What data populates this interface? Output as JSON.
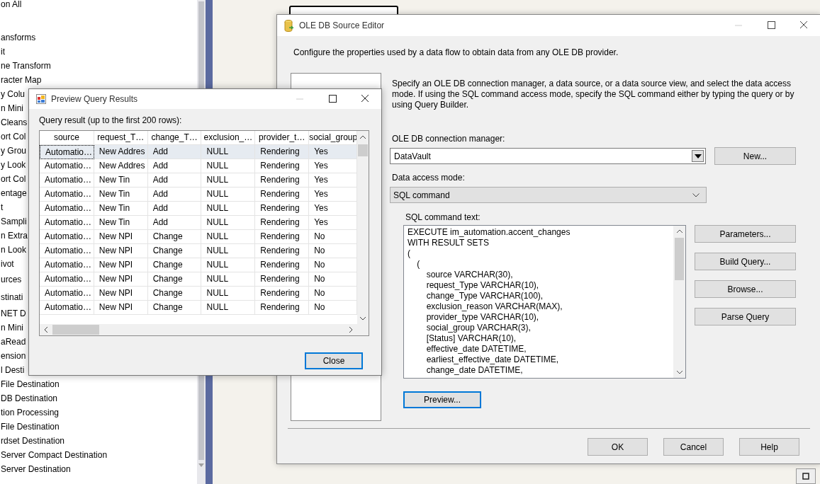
{
  "left_panel": {
    "items": [
      {
        "label": "on All",
        "kind": "header"
      },
      {
        "label": "ansforms",
        "kind": "item"
      },
      {
        "label": "it",
        "kind": "item"
      },
      {
        "label": "ne Transform",
        "kind": "item"
      },
      {
        "label": "racter Map",
        "kind": "item"
      },
      {
        "label": "y Colu",
        "kind": "item"
      },
      {
        "label": "n Mini",
        "kind": "item"
      },
      {
        "label": "Cleans",
        "kind": "item"
      },
      {
        "label": "ort Col",
        "kind": "item"
      },
      {
        "label": "y Grou",
        "kind": "item"
      },
      {
        "label": "y Look",
        "kind": "item"
      },
      {
        "label": "ort Col",
        "kind": "item"
      },
      {
        "label": "entage",
        "kind": "item"
      },
      {
        "label": "t",
        "kind": "item"
      },
      {
        "label": "Sampli",
        "kind": "item"
      },
      {
        "label": "n Extra",
        "kind": "item"
      },
      {
        "label": "n Look",
        "kind": "item"
      },
      {
        "label": "ivot",
        "kind": "item"
      },
      {
        "label": "urces",
        "kind": "header"
      },
      {
        "label": "stinati",
        "kind": "header"
      },
      {
        "label": "NET D",
        "kind": "item"
      },
      {
        "label": "n Mini",
        "kind": "item"
      },
      {
        "label": "aRead",
        "kind": "item"
      },
      {
        "label": "ension",
        "kind": "item"
      },
      {
        "label": "l Desti",
        "kind": "item"
      },
      {
        "label": "File Destination",
        "kind": "item"
      },
      {
        "label": "DB Destination",
        "kind": "item"
      },
      {
        "label": "tion Processing",
        "kind": "item"
      },
      {
        "label": "File Destination",
        "kind": "item"
      },
      {
        "label": "rdset Destination",
        "kind": "item"
      },
      {
        "label": "Server Compact Destination",
        "kind": "item"
      },
      {
        "label": "Server Destination",
        "kind": "item"
      }
    ]
  },
  "editor": {
    "title": "OLE DB Source Editor",
    "description": "Configure the properties used by a data flow to obtain data from any OLE DB provider.",
    "instructions": "Specify an OLE DB connection manager, a data source, or a data source view, and select the data access mode. If using the SQL command access mode, specify the SQL command either by typing the query or by using Query Builder.",
    "connection_label": "OLE DB connection manager:",
    "connection_value": "DataVault",
    "new_button": "New...",
    "access_mode_label": "Data access mode:",
    "access_mode_value": "SQL command",
    "sql_label": "SQL command text:",
    "sql_text": "EXECUTE im_automation.accent_changes\nWITH RESULT SETS\n(\n    (\n        source VARCHAR(30),\n        request_Type VARCHAR(10),\n        change_Type VARCHAR(100),\n        exclusion_reason VARCHAR(MAX),\n        provider_type VARCHAR(10),\n        social_group VARCHAR(3),\n        [Status] VARCHAR(10),\n        effective_date DATETIME,\n        earliest_effective_date DATETIME,\n        change_date DATETIME,",
    "side_buttons": [
      "Parameters...",
      "Build Query...",
      "Browse...",
      "Parse Query"
    ],
    "preview_button": {
      "label": "Preview...",
      "focused": true
    },
    "footer_buttons": [
      "OK",
      "Cancel",
      "Help"
    ]
  },
  "preview": {
    "title": "Preview Query Results",
    "caption": "Query result (up to the first 200 rows):",
    "columns": [
      "source",
      "request_T…",
      "change_T…",
      "exclusion_…",
      "provider_t…",
      "social_group"
    ],
    "rows": [
      {
        "selected": true,
        "cells": [
          "Automatio…",
          "New Addres",
          "Add",
          "NULL",
          "Rendering",
          "Yes"
        ]
      },
      {
        "selected": false,
        "cells": [
          "Automatio…",
          "New Addres",
          "Add",
          "NULL",
          "Rendering",
          "Yes"
        ]
      },
      {
        "selected": false,
        "cells": [
          "Automatio…",
          "New Tin",
          "Add",
          "NULL",
          "Rendering",
          "Yes"
        ]
      },
      {
        "selected": false,
        "cells": [
          "Automatio…",
          "New Tin",
          "Add",
          "NULL",
          "Rendering",
          "Yes"
        ]
      },
      {
        "selected": false,
        "cells": [
          "Automatio…",
          "New Tin",
          "Add",
          "NULL",
          "Rendering",
          "Yes"
        ]
      },
      {
        "selected": false,
        "cells": [
          "Automatio…",
          "New Tin",
          "Add",
          "NULL",
          "Rendering",
          "Yes"
        ]
      },
      {
        "selected": false,
        "cells": [
          "Automatio…",
          "New NPI",
          "Change",
          "NULL",
          "Rendering",
          "No"
        ]
      },
      {
        "selected": false,
        "cells": [
          "Automatio…",
          "New NPI",
          "Change",
          "NULL",
          "Rendering",
          "No"
        ]
      },
      {
        "selected": false,
        "cells": [
          "Automatio…",
          "New NPI",
          "Change",
          "NULL",
          "Rendering",
          "No"
        ]
      },
      {
        "selected": false,
        "cells": [
          "Automatio…",
          "New NPI",
          "Change",
          "NULL",
          "Rendering",
          "No"
        ]
      },
      {
        "selected": false,
        "cells": [
          "Automatio…",
          "New NPI",
          "Change",
          "NULL",
          "Rendering",
          "No"
        ]
      },
      {
        "selected": false,
        "cells": [
          "Automatio…",
          "New NPI",
          "Change",
          "NULL",
          "Rendering",
          "No"
        ]
      }
    ],
    "close_button": {
      "label": "Close",
      "focused": true
    }
  }
}
